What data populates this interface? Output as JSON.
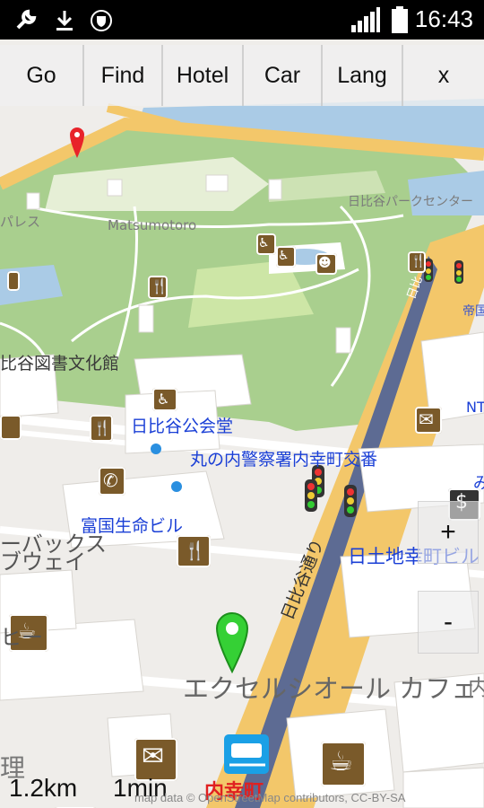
{
  "status_bar": {
    "time": "16:43"
  },
  "toolbar": {
    "buttons": [
      "Go",
      "Find",
      "Hotel",
      "Car",
      "Lang",
      "x"
    ]
  },
  "map_labels": {
    "matsumotoro": "Matsumotoro",
    "hibiya_park_center": "日比谷パークセンター",
    "palace": "パレス",
    "library": "比谷図書文化館",
    "hibiya_hall": "日比谷公会堂",
    "police_box": "丸の内警察署内幸町交番",
    "fukoku_building": "富国生命ビル",
    "starbucks": "ーバックス",
    "starbucks_2": "ブウェイ",
    "coffee": "ヒー",
    "nittochi": "日土地幸町ビル",
    "hibiya_dori": "日比谷通り",
    "excelsior": "エクセルシオール カフェ",
    "uchisaiwaicho": "内幸町",
    "ri": "理",
    "teiko": "帝国",
    "nt": "NT",
    "mi": "み",
    "uchi": "内",
    "hibiya_small": "日比"
  },
  "zoom": {
    "in_label": "+",
    "out_label": "-"
  },
  "route_info": {
    "distance": "1.2km",
    "time": "1min"
  },
  "attribution": "map data © OpenStreetMap contributors, CC-BY-SA",
  "colors": {
    "park": "#a9cf8e",
    "major_road": "#f3c76a",
    "route": "#5d6b93",
    "water": "#aacbe6",
    "poi": "#7a5a2a",
    "label_blue": "#1a3fd6",
    "station_red": "#e02020"
  }
}
